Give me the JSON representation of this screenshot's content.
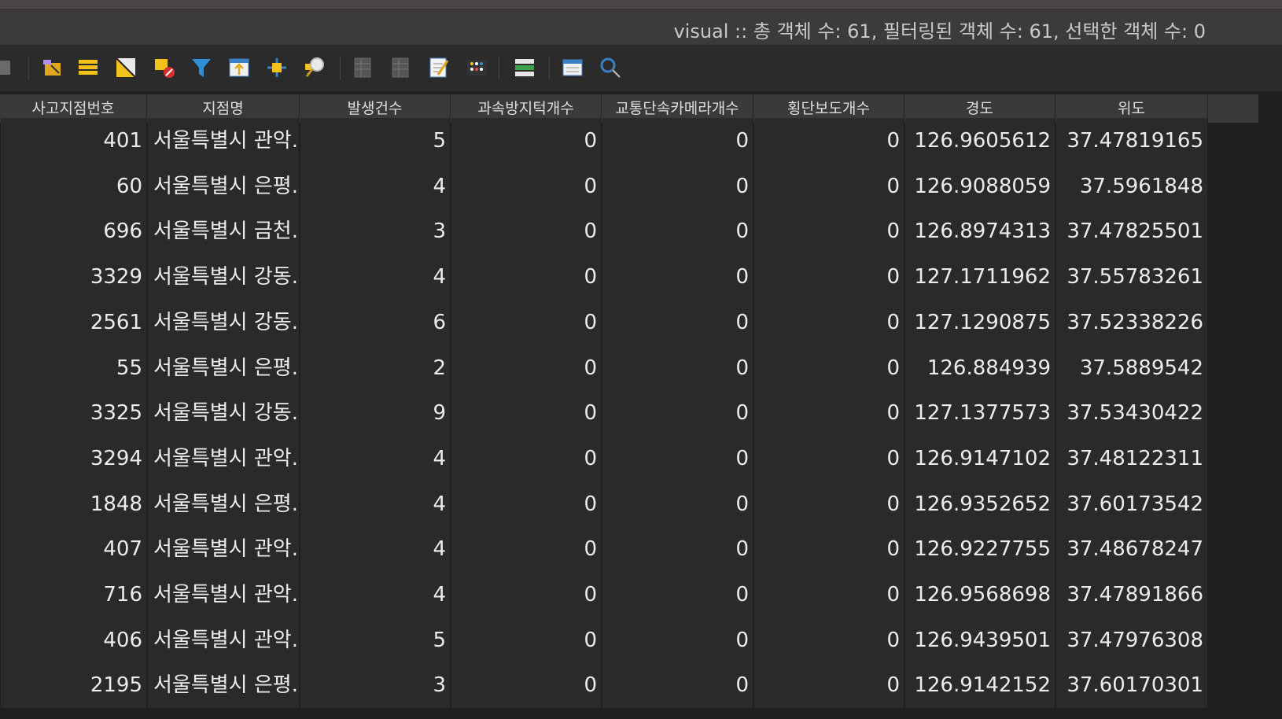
{
  "window": {
    "title": "visual :: 총 객체 수: 61, 필터링된 객체 수: 61, 선택한 객체 수: 0"
  },
  "toolbar": {
    "buttons": [
      {
        "name": "toggle-editing-icon"
      },
      {
        "name": "select-all-icon"
      },
      {
        "name": "invert-selection-icon"
      },
      {
        "name": "deselect-all-icon"
      },
      {
        "name": "filter-select-icon"
      },
      {
        "name": "move-selection-top-icon"
      },
      {
        "name": "pan-to-selected-icon"
      },
      {
        "name": "zoom-to-selected-icon"
      },
      {
        "name": "new-field-icon"
      },
      {
        "name": "delete-field-icon"
      },
      {
        "name": "field-calculator-icon"
      },
      {
        "name": "conditional-formatting-icon"
      },
      {
        "name": "dock-table-icon"
      },
      {
        "name": "actions-icon"
      },
      {
        "name": "zoom-map-icon"
      }
    ]
  },
  "table": {
    "columns": [
      "사고지점번호",
      "지점명",
      "발생건수",
      "과속방지턱개수",
      "교통단속카메라개수",
      "횡단보도개수",
      "경도",
      "위도"
    ],
    "rows": [
      [
        "401",
        "서울특별시 관악...",
        "5",
        "0",
        "0",
        "0",
        "126.9605612",
        "37.47819165"
      ],
      [
        "60",
        "서울특별시 은평...",
        "4",
        "0",
        "0",
        "0",
        "126.9088059",
        "37.5961848"
      ],
      [
        "696",
        "서울특별시 금천...",
        "3",
        "0",
        "0",
        "0",
        "126.8974313",
        "37.47825501"
      ],
      [
        "3329",
        "서울특별시 강동...",
        "4",
        "0",
        "0",
        "0",
        "127.1711962",
        "37.55783261"
      ],
      [
        "2561",
        "서울특별시 강동...",
        "6",
        "0",
        "0",
        "0",
        "127.1290875",
        "37.52338226"
      ],
      [
        "55",
        "서울특별시 은평...",
        "2",
        "0",
        "0",
        "0",
        "126.884939",
        "37.5889542"
      ],
      [
        "3325",
        "서울특별시 강동...",
        "9",
        "0",
        "0",
        "0",
        "127.1377573",
        "37.53430422"
      ],
      [
        "3294",
        "서울특별시 관악...",
        "4",
        "0",
        "0",
        "0",
        "126.9147102",
        "37.48122311"
      ],
      [
        "1848",
        "서울특별시 은평...",
        "4",
        "0",
        "0",
        "0",
        "126.9352652",
        "37.60173542"
      ],
      [
        "407",
        "서울특별시 관악...",
        "4",
        "0",
        "0",
        "0",
        "126.9227755",
        "37.48678247"
      ],
      [
        "716",
        "서울특별시 관악...",
        "4",
        "0",
        "0",
        "0",
        "126.9568698",
        "37.47891866"
      ],
      [
        "406",
        "서울특별시 관악...",
        "5",
        "0",
        "0",
        "0",
        "126.9439501",
        "37.47976308"
      ],
      [
        "2195",
        "서울특별시 은평...",
        "3",
        "0",
        "0",
        "0",
        "126.9142152",
        "37.60170301"
      ]
    ]
  }
}
